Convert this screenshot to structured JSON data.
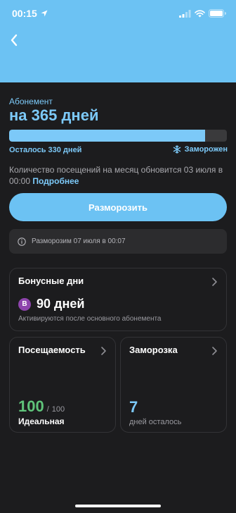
{
  "status_bar": {
    "time": "00:15"
  },
  "subscription": {
    "label": "Абонемент",
    "title": "на 365 дней",
    "progress_fraction": 0.9,
    "remaining": "Осталось 330 дней",
    "frozen_status": "Заморожен",
    "info_text": "Количество посещений на месяц обновится 03 июля в 00:00",
    "info_link": "Подробнее"
  },
  "unfreeze_button": {
    "label": "Разморозить"
  },
  "notice": {
    "text": "Разморозим 07 июля в 00:07"
  },
  "bonus_card": {
    "title": "Бонусные дни",
    "badge": "B",
    "value": "90 дней",
    "note": "Активируются после основного абонемента"
  },
  "attendance_card": {
    "title": "Посещаемость",
    "value": "100",
    "separator": "/",
    "max": "100",
    "label": "Идеальная"
  },
  "freeze_card": {
    "title": "Заморозка",
    "value": "7",
    "label": "дней осталось"
  },
  "colors": {
    "accent": "#7cc9f8",
    "header_bg": "#6cc2f3",
    "success": "#5fc47a",
    "bonus_badge": "#8e44ad"
  },
  "icons": [
    "location-arrow-icon",
    "signal-icon",
    "wifi-icon",
    "battery-icon",
    "back-chevron-icon",
    "snowflake-icon",
    "info-icon",
    "chevron-right-icon"
  ]
}
